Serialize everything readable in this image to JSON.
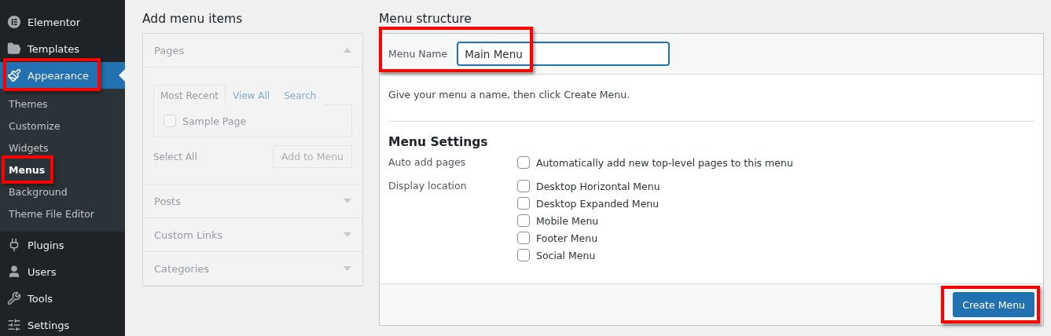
{
  "sidebar": {
    "items": [
      {
        "label": "Elementor",
        "selected": false,
        "highlighted": false
      },
      {
        "label": "Templates",
        "selected": false,
        "highlighted": false
      },
      {
        "label": "Appearance",
        "selected": true,
        "highlighted": true,
        "children": [
          {
            "label": "Themes",
            "selected": false,
            "highlighted": false
          },
          {
            "label": "Customize",
            "selected": false,
            "highlighted": false
          },
          {
            "label": "Widgets",
            "selected": false,
            "highlighted": false
          },
          {
            "label": "Menus",
            "selected": true,
            "highlighted": true
          },
          {
            "label": "Background",
            "selected": false,
            "highlighted": false
          },
          {
            "label": "Theme File Editor",
            "selected": false,
            "highlighted": false
          }
        ]
      },
      {
        "label": "Plugins",
        "selected": false,
        "highlighted": false
      },
      {
        "label": "Users",
        "selected": false,
        "highlighted": false
      },
      {
        "label": "Tools",
        "selected": false,
        "highlighted": false
      },
      {
        "label": "Settings",
        "selected": false,
        "highlighted": false
      }
    ]
  },
  "add_menu_items": {
    "title": "Add menu items",
    "disabled": true,
    "sections": [
      {
        "title": "Pages",
        "expanded": true,
        "tabs": [
          {
            "label": "Most Recent",
            "selected": true
          },
          {
            "label": "View All",
            "selected": false
          },
          {
            "label": "Search",
            "selected": false
          }
        ],
        "items": [
          {
            "label": "Sample Page",
            "checked": false
          }
        ],
        "select_all": "Select All",
        "add_button": "Add to Menu"
      },
      {
        "title": "Posts",
        "expanded": false
      },
      {
        "title": "Custom Links",
        "expanded": false
      },
      {
        "title": "Categories",
        "expanded": false
      }
    ]
  },
  "menu_structure": {
    "title": "Menu structure",
    "menu_name": {
      "label": "Menu Name",
      "value": "Main Menu",
      "highlighted": true
    },
    "hint": "Give your menu a name, then click Create Menu.",
    "settings_title": "Menu Settings",
    "settings": [
      {
        "label": "Auto add pages",
        "options": [
          {
            "label": "Automatically add new top-level pages to this menu",
            "checked": false
          }
        ]
      },
      {
        "label": "Display location",
        "options": [
          {
            "label": "Desktop Horizontal Menu",
            "checked": false
          },
          {
            "label": "Desktop Expanded Menu",
            "checked": false
          },
          {
            "label": "Mobile Menu",
            "checked": false
          },
          {
            "label": "Footer Menu",
            "checked": false
          },
          {
            "label": "Social Menu",
            "checked": false
          }
        ]
      }
    ],
    "create_button": {
      "label": "Create Menu",
      "highlighted": true
    }
  }
}
